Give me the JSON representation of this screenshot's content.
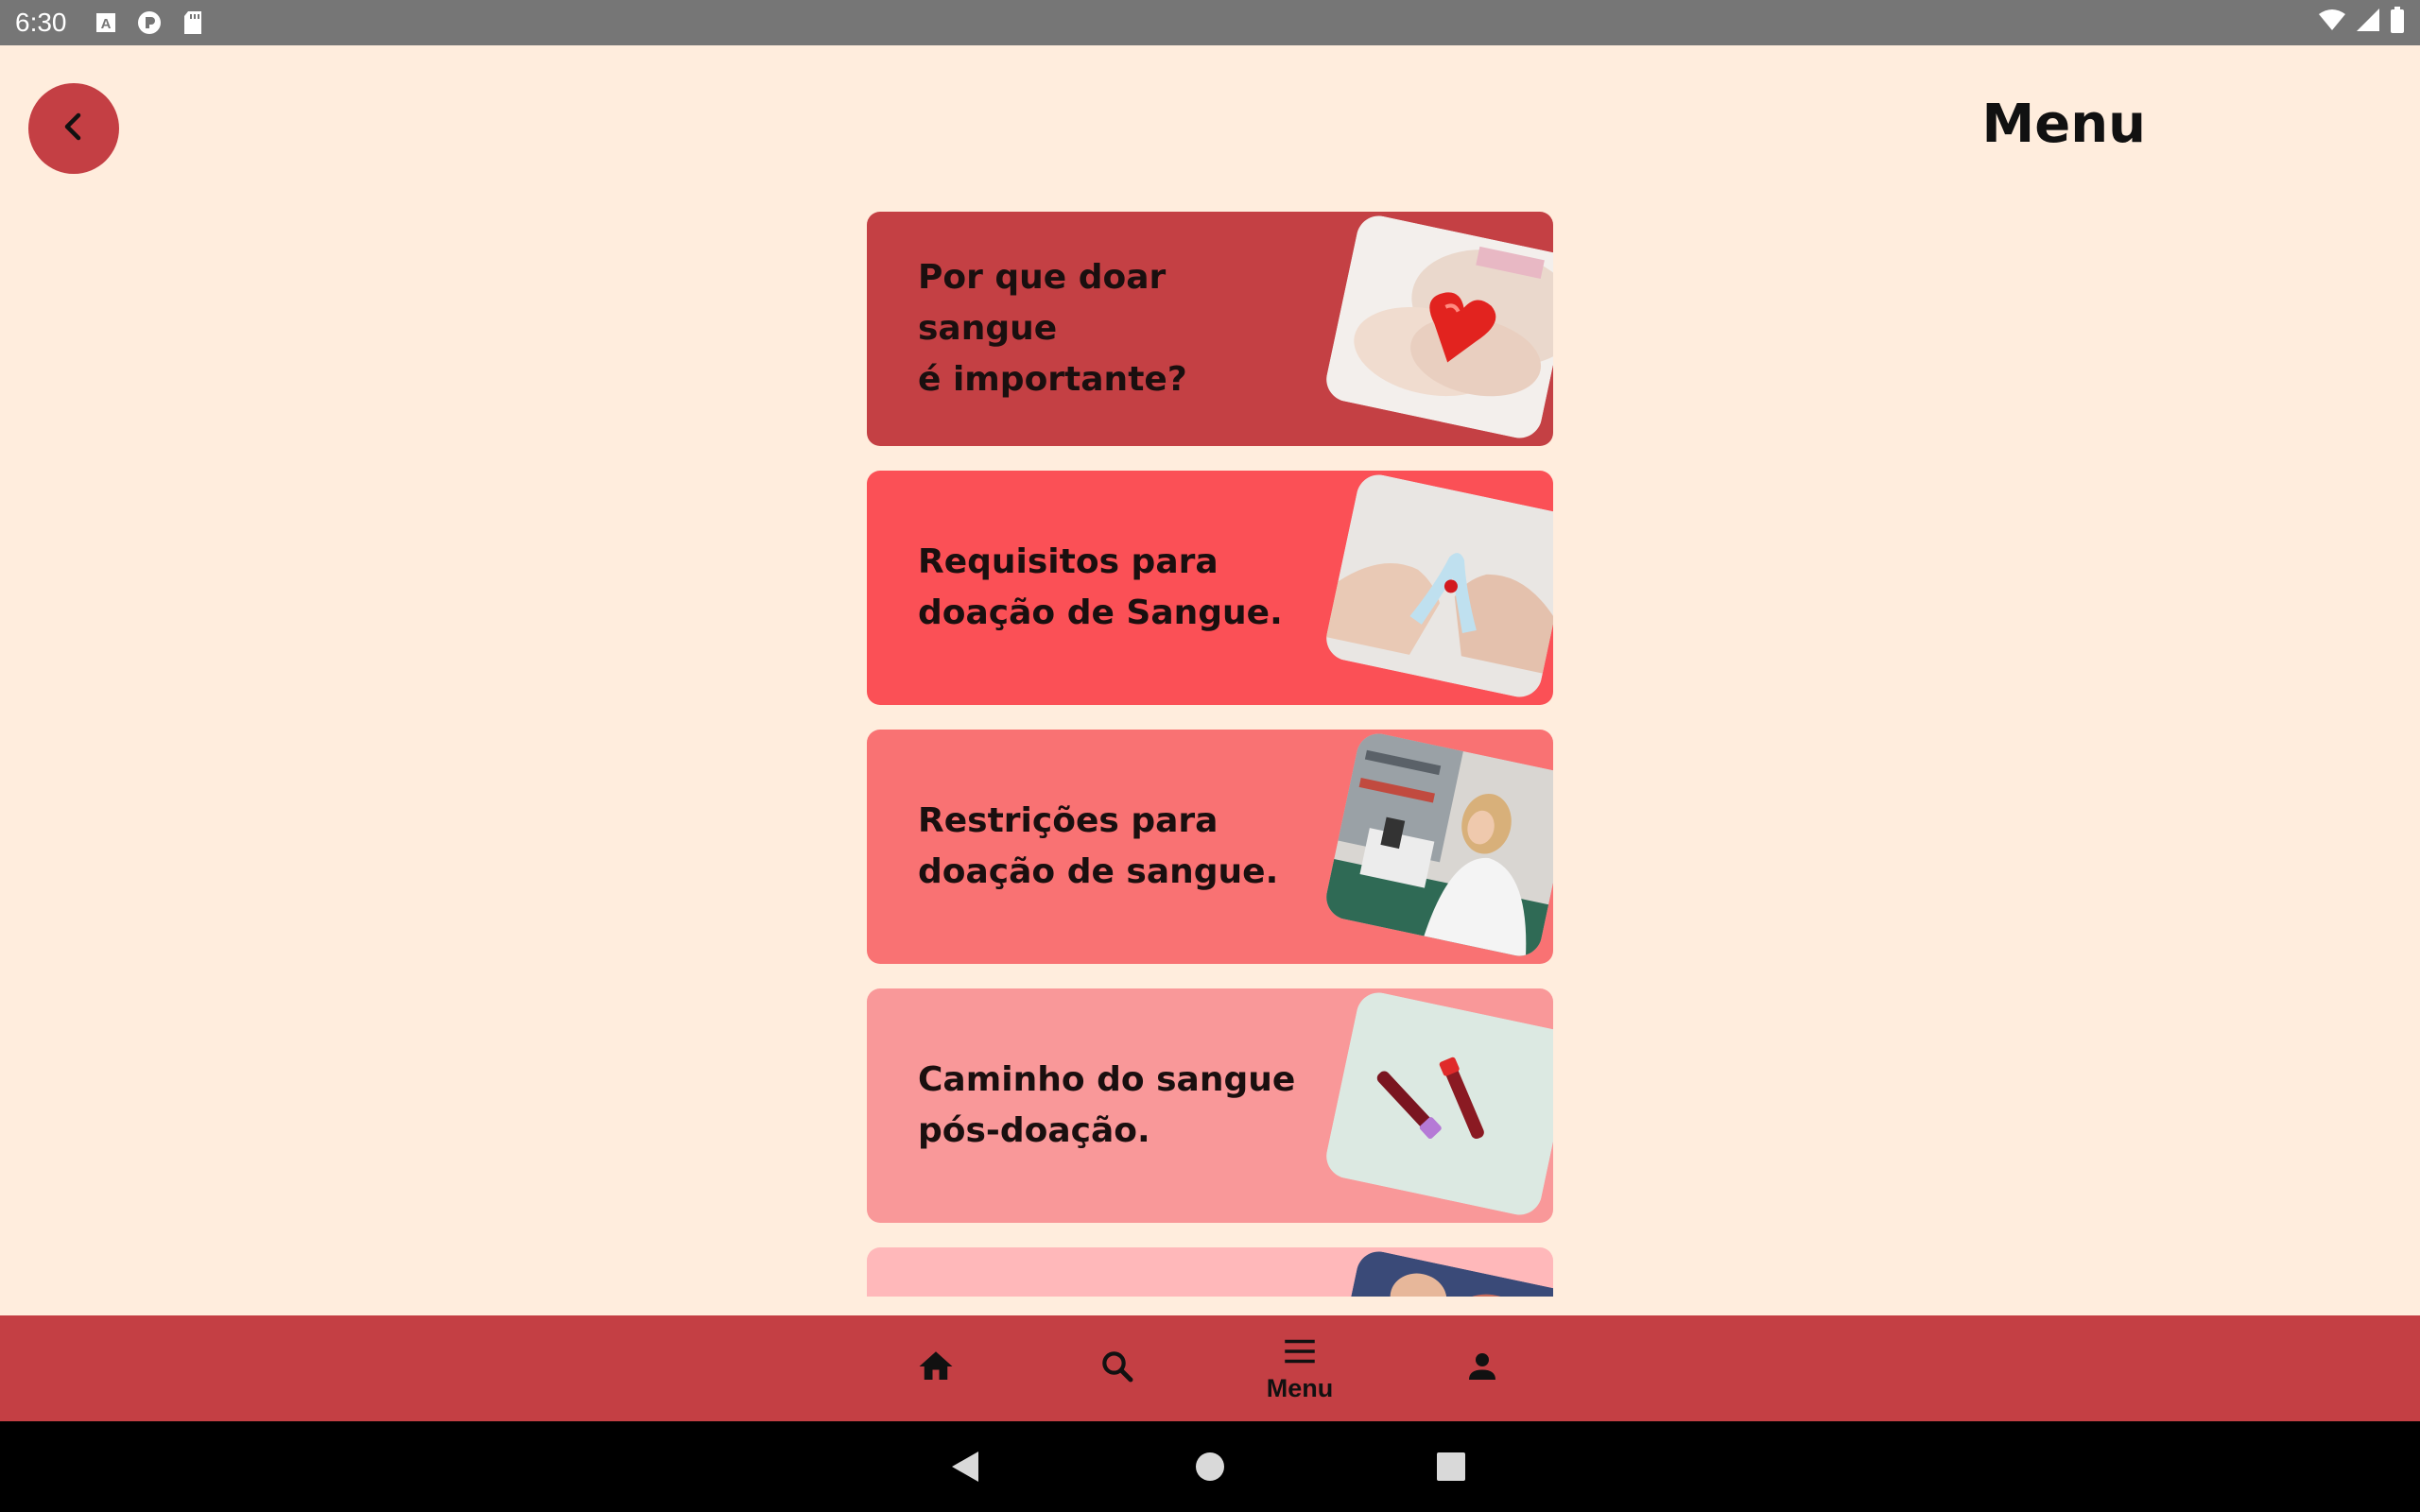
{
  "status_bar": {
    "time": "6:30",
    "left_icons": [
      "font-icon",
      "podcast-icon",
      "sd-card-icon"
    ],
    "right_icons": [
      "wifi-icon",
      "signal-icon",
      "battery-icon"
    ]
  },
  "header": {
    "title": "Menu",
    "back_icon": "chevron-left-icon"
  },
  "colors": {
    "background": "#ffeddd",
    "primary": "#c43f44",
    "card_1": "#c44044",
    "card_2": "#fb5056",
    "card_3": "#f97273",
    "card_4": "#f99899",
    "card_5": "#ffb8ba"
  },
  "cards": [
    {
      "label": "Por que doar sangue\né importante?",
      "image": "hands-holding-heart"
    },
    {
      "label": "Requisitos para\ndoação de Sangue.",
      "image": "hands-holding-ribbon"
    },
    {
      "label": "Restrições para\ndoação de sangue.",
      "image": "lab-technician-microscope"
    },
    {
      "label": "Caminho do sangue\npós-doação.",
      "image": "blood-sample-tubes"
    },
    {
      "label": "",
      "image": "people-photo"
    }
  ],
  "bottom_nav": {
    "items": [
      {
        "icon": "home-icon",
        "label": ""
      },
      {
        "icon": "search-icon",
        "label": ""
      },
      {
        "icon": "menu-icon",
        "label": "Menu"
      },
      {
        "icon": "person-icon",
        "label": ""
      }
    ]
  },
  "system_nav": [
    "back-triangle-icon",
    "home-circle-icon",
    "recents-square-icon"
  ]
}
